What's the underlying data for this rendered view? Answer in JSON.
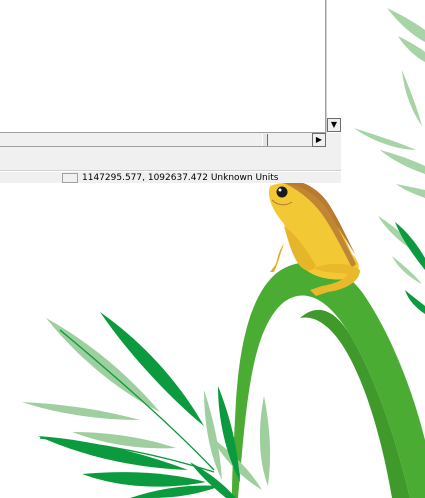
{
  "window": {
    "status_coordinates": "1147295.577, 1092637.472 Unknown Units"
  },
  "colors": {
    "window_background": "#f0f0f0",
    "frog_yellow": "#f2c934",
    "frog_brown": "#b77a2e",
    "stem_green": "#4bac34",
    "leaf_green": "#0b9b3e",
    "leaf_light_green": "#9fcf9f"
  },
  "icons": {
    "scroll_down": "triangle-down-icon",
    "scroll_right": "triangle-right-icon"
  }
}
